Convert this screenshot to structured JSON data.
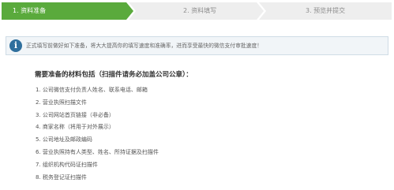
{
  "stepper": {
    "steps": [
      {
        "label": "1. 资料准备",
        "state": "active"
      },
      {
        "label": "2. 资料填写",
        "state": "inactive"
      },
      {
        "label": "3. 预览并提交",
        "state": "inactive"
      }
    ],
    "active_color": "#5aaa3c",
    "inactive_color": "#eeeeee"
  },
  "notice": {
    "icon": "info-icon",
    "icon_glyph": "i",
    "text": "正式填写前做好如下准备，将大大提高你的填写速度和准确率，进而享受最快的微信支付审批速度！"
  },
  "materials": {
    "heading": "需要准备的材料包括（扫描件请务必加盖公司公章）：",
    "items": [
      "1. 公司微信支付负责人姓名、联系电话、邮箱",
      "2. 营业执照扫描文件",
      "3. 公司网站首页链接（非必备）",
      "4. 商家名称（将用于对外展示）",
      "5. 公司地址及邮政编码",
      "6. 营业执照持有人类型、姓名、所持证据及扫描件",
      "7. 组织机构代码证扫描件",
      "8. 税务登记证扫描件"
    ]
  }
}
